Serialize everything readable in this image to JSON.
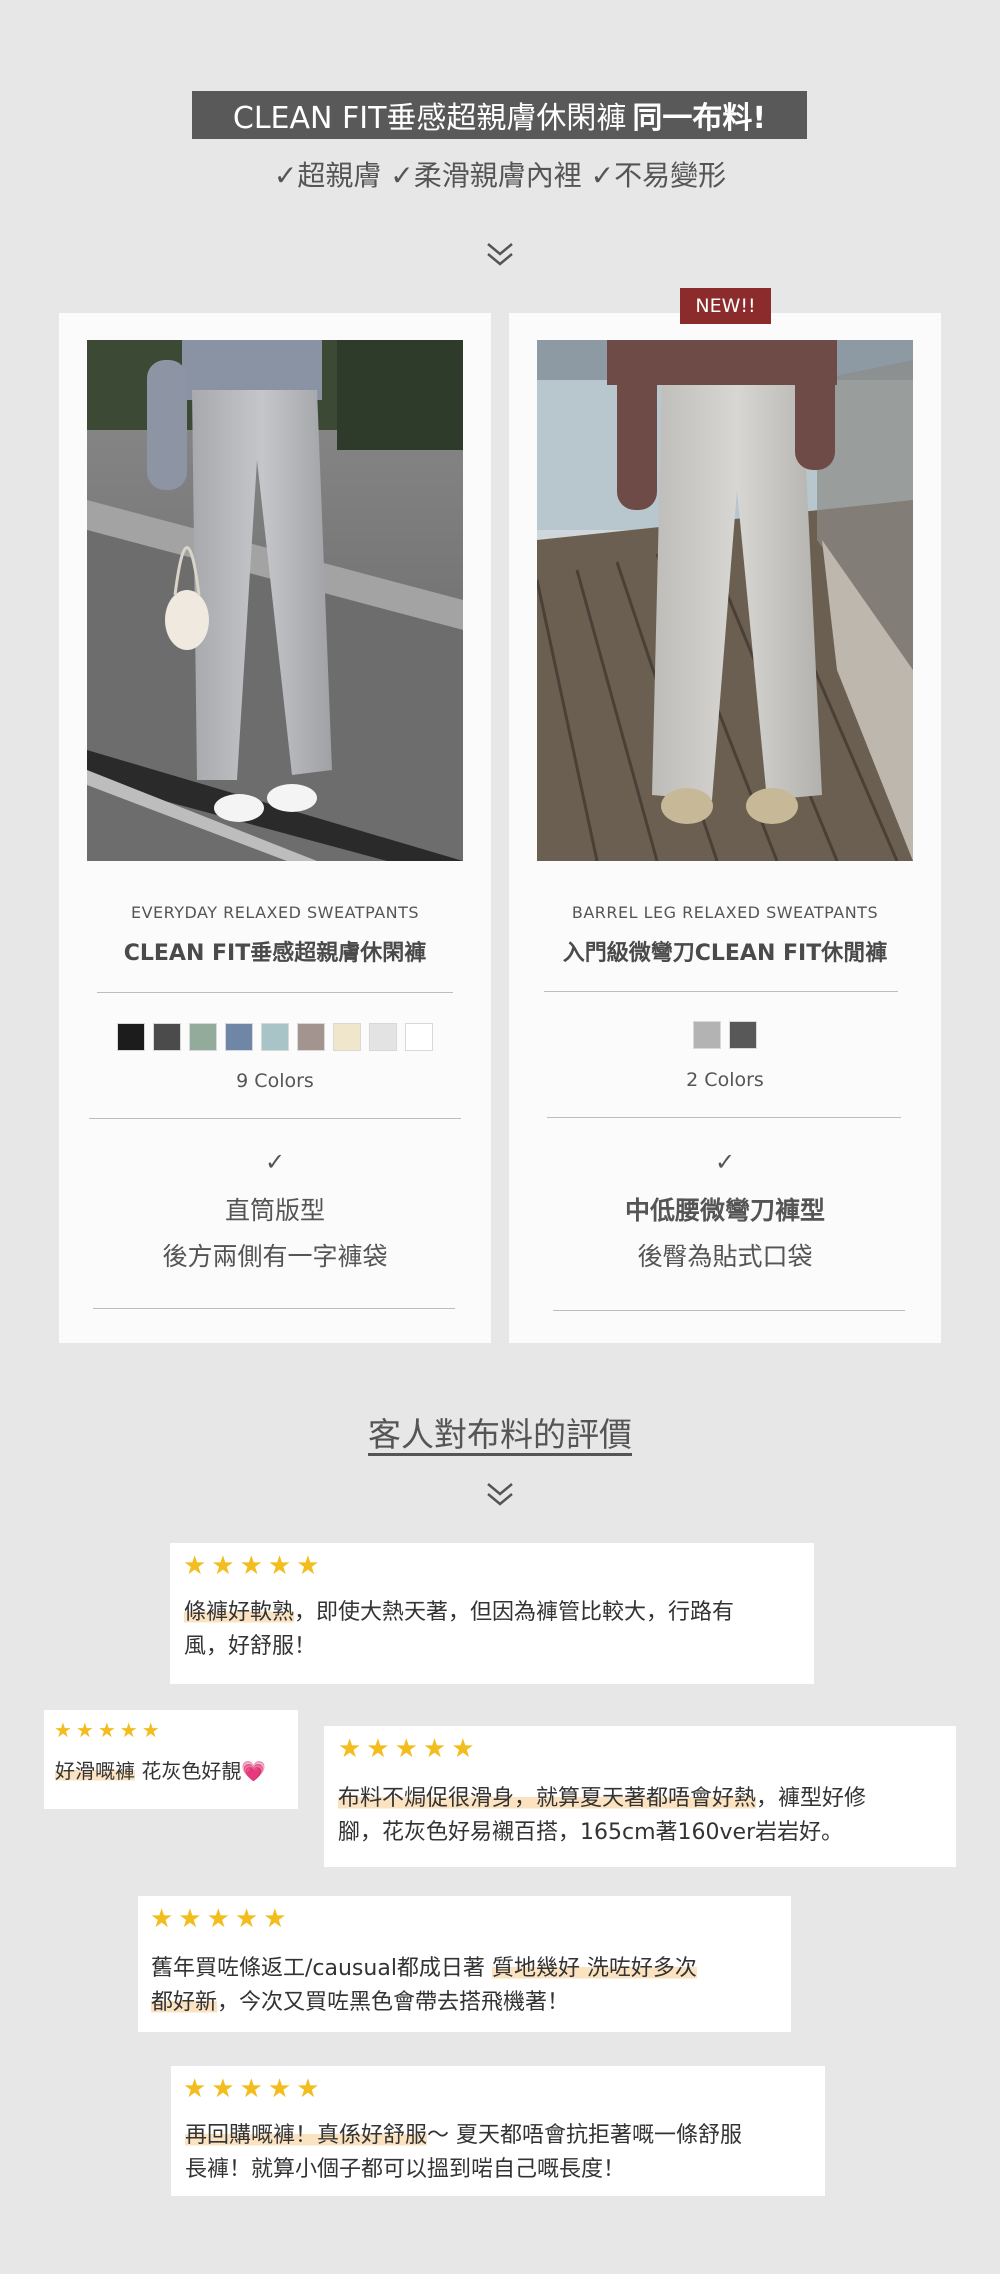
{
  "header": {
    "title_main": "CLEAN FIT垂感超親膚休閑褲",
    "title_bold": "同一布料!",
    "subtitle": "✓超親膚 ✓柔滑親膚內裡 ✓不易變形"
  },
  "products": [
    {
      "subtitle_en": "EVERYDAY RELAXED SWEATPANTS",
      "name": "CLEAN FIT垂感超親膚休閑褲",
      "swatches": [
        "#1c1c1c",
        "#4b4b4b",
        "#93ab9a",
        "#6f86a6",
        "#a9c4c6",
        "#a3948f",
        "#efe6cc",
        "#e3e3e3",
        "#ffffff"
      ],
      "colors_label": "9 Colors",
      "check": "✓",
      "feature_1": "直筒版型",
      "feature_2": "後方兩側有一字褲袋"
    },
    {
      "badge": "NEW!!",
      "subtitle_en": "BARREL LEG RELAXED SWEATPANTS",
      "name": "入門級微彎刀CLEAN FIT休閒褲",
      "swatches": [
        "#b3b3b3",
        "#585858"
      ],
      "colors_label": "2 Colors",
      "check": "✓",
      "feature_1": "中低腰微彎刀褲型",
      "feature_2": "後臀為貼式口袋"
    }
  ],
  "reviews_section": {
    "title": "客人對布料的評價"
  },
  "reviews": [
    {
      "stars": "★★★★★",
      "highlight": "條褲好軟熟",
      "text_1": "，即使大熱天著，但因為褲管比較大，行路有",
      "text_2": "風，好舒服！"
    },
    {
      "stars": "★★★★★",
      "highlight": "好滑嘅褲",
      "text": " 花灰色好靚",
      "emoji": "💗"
    },
    {
      "stars": "★★★★★",
      "highlight": "布料不焗促很滑身，就算夏天著都唔會好熱",
      "text_1": "，褲型好修",
      "text_2": "腳，花灰色好易襯百搭，165cm著160ver岩岩好。"
    },
    {
      "stars": "★★★★★",
      "text_1": "舊年買咗條返工/causual都成日著 ",
      "highlight_1": "質地幾好 洗咗好多次",
      "highlight_2": "都好新",
      "text_2": "，今次又買咗黑色會帶去搭飛機著！"
    },
    {
      "stars": "★★★★★",
      "highlight": "再回購嘅褲！真係好舒服",
      "text_1": "～ 夏天都唔會抗拒著嘅一條舒服",
      "text_2": "長褲！就算小個子都可以搵到啱自己嘅長度！"
    }
  ]
}
